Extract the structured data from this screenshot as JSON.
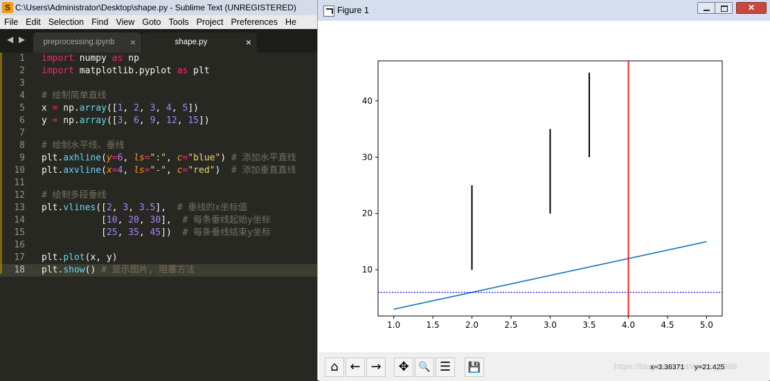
{
  "sublime": {
    "title": "C:\\Users\\Administrator\\Desktop\\shape.py - Sublime Text (UNREGISTERED)",
    "menu": [
      "File",
      "Edit",
      "Selection",
      "Find",
      "View",
      "Goto",
      "Tools",
      "Project",
      "Preferences",
      "He"
    ],
    "tabs": [
      {
        "label": "preprocessing.ipynb",
        "close": "×"
      },
      {
        "label": "shape.py",
        "close": "×"
      }
    ],
    "nav_arrows": "◀ ▶",
    "line_numbers": [
      "1",
      "2",
      "3",
      "4",
      "5",
      "6",
      "7",
      "8",
      "9",
      "10",
      "11",
      "12",
      "13",
      "14",
      "15",
      "16",
      "17",
      "18"
    ],
    "code": {
      "l1": {
        "kw1": "import",
        "mod": " numpy ",
        "kw2": "as",
        "alias": " np"
      },
      "l2": {
        "kw1": "import",
        "mod": " matplotlib.pyplot ",
        "kw2": "as",
        "alias": " plt"
      },
      "l4": "# 绘制简单直线",
      "l5": {
        "a": "x ",
        "eq": "=",
        "b": " np.",
        "fn": "array",
        "c": "([",
        "n1": "1",
        "s1": ", ",
        "n2": "2",
        "s2": ", ",
        "n3": "3",
        "s3": ", ",
        "n4": "4",
        "s4": ", ",
        "n5": "5",
        "d": "])"
      },
      "l6": {
        "a": "y ",
        "eq": "=",
        "b": " np.",
        "fn": "array",
        "c": "([",
        "n1": "3",
        "s1": ", ",
        "n2": "6",
        "s2": ", ",
        "n3": "9",
        "s3": ", ",
        "n4": "12",
        "s4": ", ",
        "n5": "15",
        "d": "])"
      },
      "l8": "# 绘制水平线、垂线",
      "l9": {
        "a": "plt.",
        "fn": "axhline",
        "b": "(",
        "p1": "y",
        "eq1": "=",
        "n1": "6",
        "s1": ", ",
        "p2": "ls",
        "eq2": "=",
        "v2": "\":\"",
        "s2": ", ",
        "p3": "c",
        "eq3": "=",
        "v3": "\"blue\"",
        "c": ") ",
        "cm": "# 添加水平直线"
      },
      "l10": {
        "a": "plt.",
        "fn": "axvline",
        "b": "(",
        "p1": "x",
        "eq1": "=",
        "n1": "4",
        "s1": ", ",
        "p2": "ls",
        "eq2": "=",
        "v2": "\"-\"",
        "s2": ", ",
        "p3": "c",
        "eq3": "=",
        "v3": "\"red\"",
        "c": ")  ",
        "cm": "# 添加垂直直线"
      },
      "l12": "# 绘制多段垂线",
      "l13": {
        "a": "plt.",
        "fn": "vlines",
        "b": "([",
        "n1": "2",
        "s1": ", ",
        "n2": "3",
        "s2": ", ",
        "n3": "3.5",
        "c": "],  ",
        "cm": "# 垂线的x坐标值"
      },
      "l14": {
        "a": "           [",
        "n1": "10",
        "s1": ", ",
        "n2": "20",
        "s2": ", ",
        "n3": "30",
        "c": "],  ",
        "cm": "# 每条垂线起始y坐标"
      },
      "l15": {
        "a": "           [",
        "n1": "25",
        "s1": ", ",
        "n2": "35",
        "s2": ", ",
        "n3": "45",
        "c": "])  ",
        "cm": "# 每条垂线结束y坐标"
      },
      "l17": {
        "a": "plt.",
        "fn": "plot",
        "b": "(x, y)"
      },
      "l18": {
        "a": "plt.",
        "fn": "show",
        "b": "() ",
        "cm": "# 显示图片, 阻塞方法"
      }
    }
  },
  "figure": {
    "title": "Figure 1",
    "toolbar": {
      "home": "⌂",
      "back": "←",
      "forward": "→",
      "pan": "✥",
      "zoom": "🔍",
      "configure": "☰",
      "save": "💾"
    },
    "coordinates": "x=3.36371     y=21.425",
    "watermark": "https://blog.csdn.net/weixin_1986"
  },
  "chart_data": {
    "type": "line",
    "title": "",
    "xlabel": "",
    "ylabel": "",
    "xlim": [
      0.8,
      5.2
    ],
    "ylim": [
      1.8,
      47.1
    ],
    "xticks": [
      "1.0",
      "1.5",
      "2.0",
      "2.5",
      "3.0",
      "3.5",
      "4.0",
      "4.5",
      "5.0"
    ],
    "yticks": [
      "10",
      "20",
      "30",
      "40"
    ],
    "series": [
      {
        "x": [
          1,
          2,
          3,
          4,
          5
        ],
        "y": [
          3,
          6,
          9,
          12,
          15
        ],
        "color": "#1f77b4",
        "style": "solid"
      }
    ],
    "hline": {
      "y": 6,
      "color": "blue",
      "style": "dotted"
    },
    "vline": {
      "x": 4,
      "color": "red",
      "style": "solid"
    },
    "vlines": {
      "x": [
        2,
        3,
        3.5
      ],
      "ymin": [
        10,
        20,
        30
      ],
      "ymax": [
        25,
        35,
        45
      ],
      "color": "#000000"
    },
    "grid": false
  }
}
